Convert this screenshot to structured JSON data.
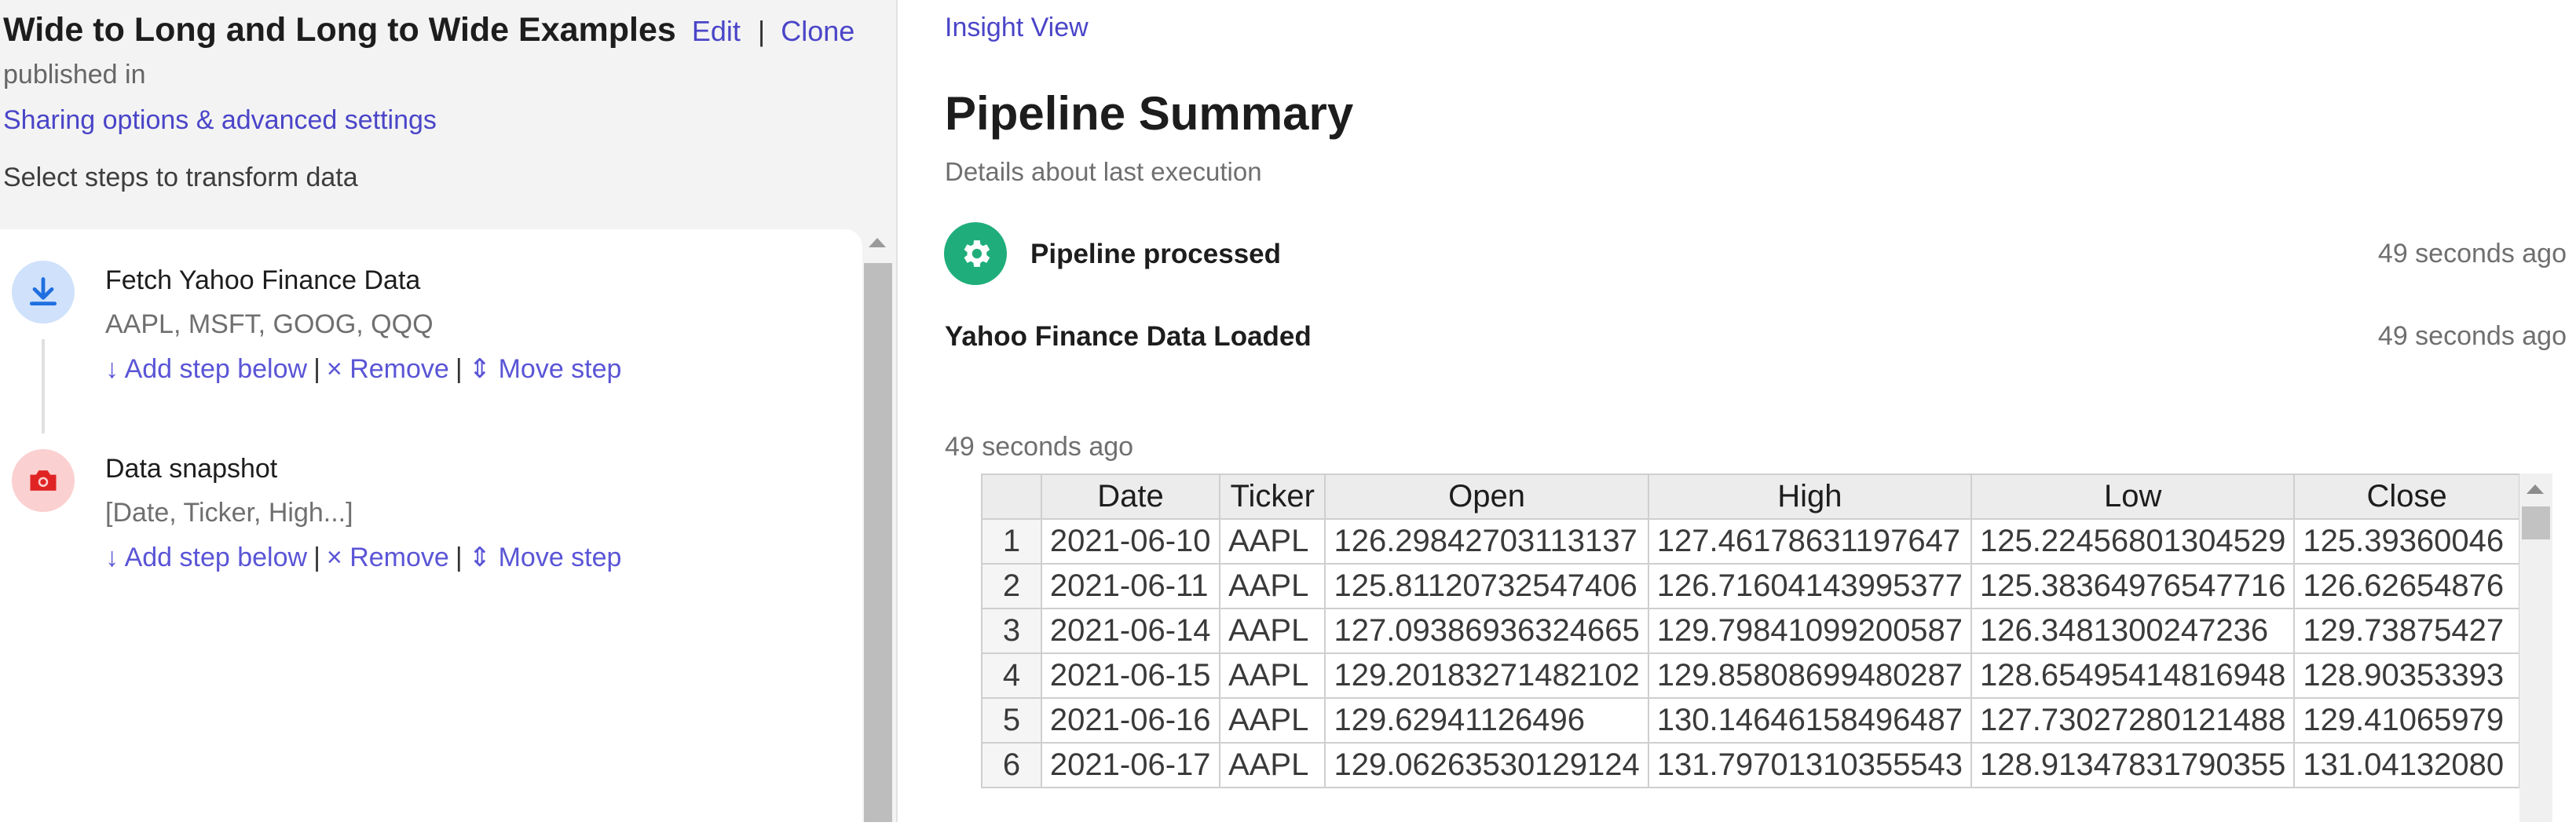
{
  "header": {
    "title": "Wide to Long and Long to Wide Examples",
    "edit_label": "Edit",
    "separator": "|",
    "clone_label": "Clone",
    "published_text": "published in",
    "sharing_link": "Sharing options & advanced settings",
    "select_steps": "Select steps to transform data"
  },
  "steps": [
    {
      "title": "Fetch Yahoo Finance Data",
      "subtitle": "AAPL, MSFT, GOOG, QQQ",
      "icon": "download-icon",
      "add_label": "↓ Add step below",
      "remove_label": "× Remove",
      "move_label": "⇕ Move step"
    },
    {
      "title": "Data snapshot",
      "subtitle": "[Date, Ticker, High...]",
      "icon": "camera-icon",
      "add_label": "↓ Add step below",
      "remove_label": "× Remove",
      "move_label": "⇕ Move step"
    }
  ],
  "action_separator": "|",
  "insight": {
    "link": "Insight View",
    "title": "Pipeline Summary",
    "subtitle": "Details about last execution",
    "events": [
      {
        "label": "Pipeline processed",
        "time": "49 seconds ago"
      },
      {
        "label": "Yahoo Finance Data Loaded",
        "time": "49 seconds ago"
      }
    ],
    "snapshot_time": "49 seconds ago"
  },
  "table": {
    "columns": [
      "",
      "Date",
      "Ticker",
      "Open",
      "High",
      "Low",
      "Close"
    ],
    "rows": [
      [
        "1",
        "2021-06-10",
        "AAPL",
        "126.29842703113137",
        "127.46178631197647",
        "125.22456801304529",
        "125.39360046"
      ],
      [
        "2",
        "2021-06-11",
        "AAPL",
        "125.81120732547406",
        "126.71604143995377",
        "125.38364976547716",
        "126.62654876"
      ],
      [
        "3",
        "2021-06-14",
        "AAPL",
        "127.09386936324665",
        "129.79841099200587",
        "126.3481300247236",
        "129.73875427"
      ],
      [
        "4",
        "2021-06-15",
        "AAPL",
        "129.20183271482102",
        "129.85808699480287",
        "128.65495414816948",
        "128.90353393"
      ],
      [
        "5",
        "2021-06-16",
        "AAPL",
        "129.62941126496",
        "130.14646158496487",
        "127.73027280121488",
        "129.41065979"
      ],
      [
        "6",
        "2021-06-17",
        "AAPL",
        "129.06263530129124",
        "131.79701310355543",
        "128.91347831790355",
        "131.04132080"
      ]
    ]
  },
  "colors": {
    "link": "#4a45c8",
    "gear_bg": "#1fae7b",
    "download_bg": "#cfe1fb",
    "camera_bg": "#fbd0d0"
  }
}
